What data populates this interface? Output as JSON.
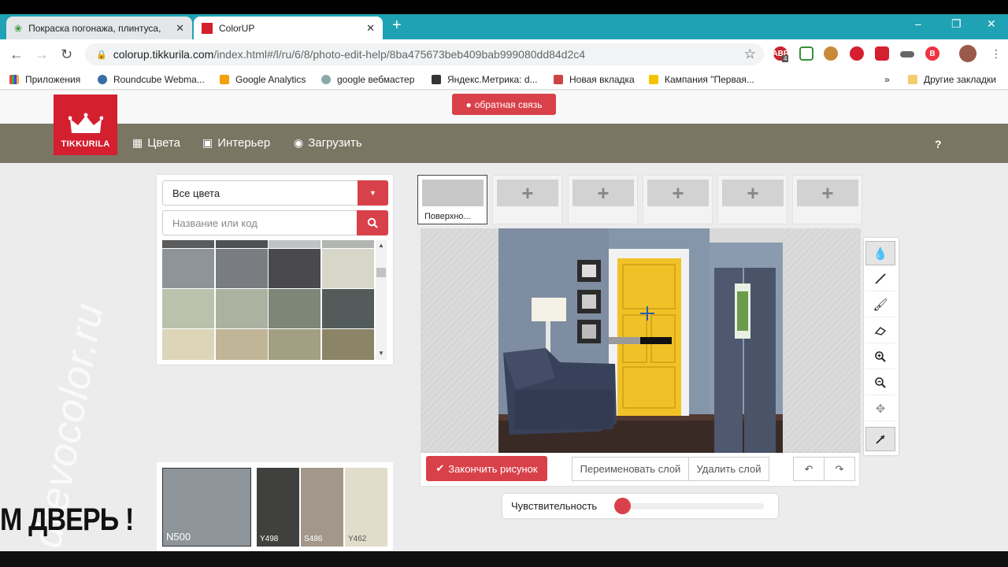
{
  "browser": {
    "tabs": [
      {
        "title": "Покраска погонажа, плинтуса, ",
        "active": false
      },
      {
        "title": "ColorUP",
        "active": true
      }
    ],
    "url_host": "colorup.tikkurila.com",
    "url_path": "/index.html#/l/ru/6/8/photo-edit-help/8ba475673beb409bab999080dd84d2c4",
    "bookmarks": [
      "Приложения",
      "Roundcube Webma...",
      "Google Analytics",
      "google вебмастер",
      "Яндекс.Метрика: d...",
      "Новая вкладка",
      "Кампания \"Первая...",
      "Другие закладки"
    ],
    "overflow": "»",
    "ext_badge": "4"
  },
  "header": {
    "feedback": "обратная связь",
    "logo_text": "TIKKURILA",
    "nav": [
      "Цвета",
      "Интерьер",
      "Загрузить"
    ],
    "help": "?"
  },
  "filters": {
    "select_value": "Все цвета",
    "search_placeholder": "Название или код"
  },
  "swatch_colors": [
    [
      "#5a5b5c",
      "#505154",
      "#c0c2c4",
      "#b3b6b0"
    ],
    [
      "#8d949a",
      "#797d82",
      "#4a494b",
      "#d6d7c9"
    ],
    [
      "#bcc1ae",
      "#adb2a0",
      "#7d8777",
      "#535c5b"
    ],
    [
      "#dcd5b8",
      "#c0b596",
      "#a39f84",
      "#8c8466"
    ]
  ],
  "layers": {
    "first_label": "Поверхно...",
    "add_symbol": "+",
    "count": 6
  },
  "tools": [
    "drop-icon",
    "line-icon",
    "brush-icon",
    "eraser-icon",
    "zoom-in-icon",
    "zoom-out-icon",
    "move-icon",
    "eyedropper-icon"
  ],
  "actions": {
    "finish": "Закончить рисунок",
    "rename": "Переименовать слой",
    "delete": "Удалить слой"
  },
  "sensitivity": {
    "label": "Чувствительность",
    "value": 0.05
  },
  "palette": [
    {
      "code": "N500",
      "color": "#8d949a"
    },
    {
      "code": "Y498",
      "color": "#40403f"
    },
    {
      "code": "S486",
      "color": "#a2978a"
    },
    {
      "code": "Y462",
      "color": "#e2dccb"
    }
  ],
  "overlay": {
    "watermark": "drevocolor.ru",
    "caption": "М ДВЕРЬ !"
  }
}
